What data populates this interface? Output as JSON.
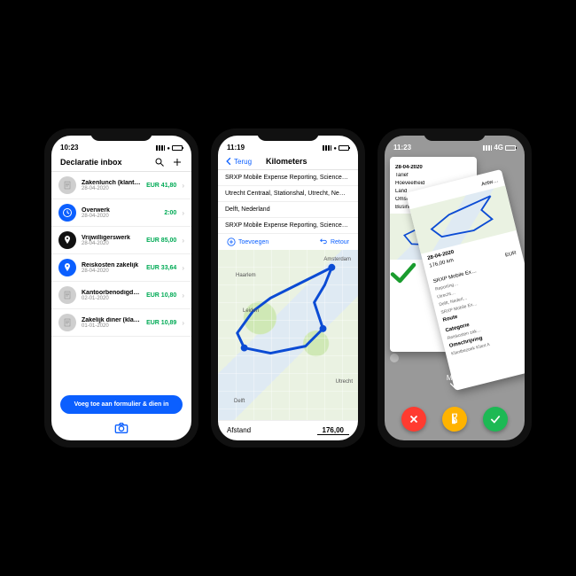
{
  "phone1": {
    "time": "10:23",
    "title": "Declaratie inbox",
    "items": [
      {
        "title": "Zakenlunch (klant in omschrijving)",
        "date": "28-04-2020",
        "amount": "EUR 41,80",
        "icon": "receipt",
        "color": "#cfcfcf"
      },
      {
        "title": "Overwerk",
        "date": "28-04-2020",
        "amount": "2:00",
        "icon": "clock",
        "color": "#0b5fff"
      },
      {
        "title": "Vrijwilligerswerk",
        "date": "28-04-2020",
        "amount": "EUR 85,00",
        "icon": "pin",
        "color": "#111"
      },
      {
        "title": "Reiskosten zakelijk",
        "date": "28-04-2020",
        "amount": "EUR 33,64",
        "icon": "pin",
        "color": "#0b5fff"
      },
      {
        "title": "Kantoorbenodigdheden",
        "date": "02-01-2020",
        "amount": "EUR 10,80",
        "icon": "receipt",
        "color": "#cfcfcf"
      },
      {
        "title": "Zakelijk diner (klant in omschrijving)",
        "date": "01-01-2020",
        "amount": "EUR 10,89",
        "icon": "receipt",
        "color": "#cfcfcf"
      }
    ],
    "submit": "Voeg toe aan formulier & dien in"
  },
  "phone2": {
    "time": "11:19",
    "back": "Terug",
    "title": "Kilometers",
    "addresses": [
      "SRXP Mobile Expense Reporting, Science…",
      "Utrecht Centraal, Stationshal, Utrecht, Ne…",
      "Delft, Nederland",
      "SRXP Mobile Expense Reporting, Science…"
    ],
    "add": "Toevoegen",
    "retour": "Retour",
    "cities": {
      "amsterdam": "Amsterdam",
      "utrecht": "Utrecht",
      "delft": "Delft",
      "haarlem": "Haarlem",
      "leiden": "Leiden"
    },
    "distanceLabel": "Afstand",
    "distanceValue": "176,00"
  },
  "phone3": {
    "time": "11:23",
    "back_sheet": {
      "date": "28-04-2020",
      "f1": "Tarief",
      "f2": "Hoeveelheid",
      "f3": "Land",
      "f4": "Omschrijving",
      "f5": "Businesstrip A…"
    },
    "front_sheet": {
      "l1": "Antw…",
      "date": "28-04-2020",
      "dist": "176,00 km",
      "eur": "EUR",
      "org": "SRXP Mobile Ex…",
      "report": "Reporting…",
      "loc1": "Utrecht…",
      "loc2": "Delft, Nederl…",
      "org2": "SRXP Mobile Ex…",
      "cat": "Categorie",
      "catv": "Reiskosten zak…",
      "desc": "Omschrijving",
      "descv": "Klantbezoek Klant A",
      "route": "Route"
    },
    "more": "Meer"
  }
}
